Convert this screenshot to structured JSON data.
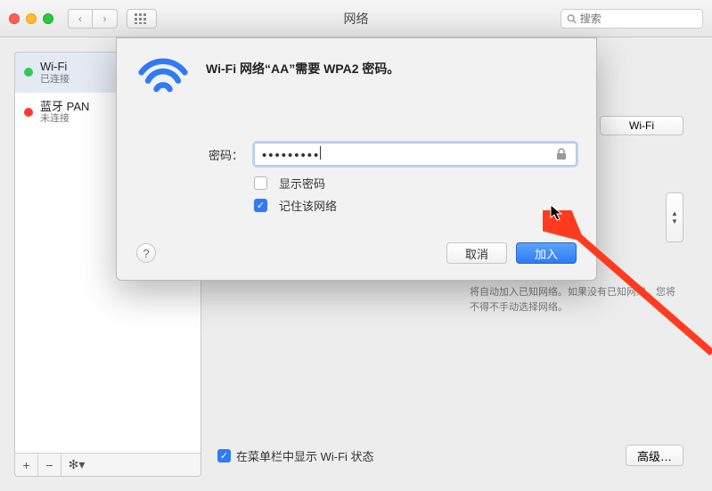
{
  "window": {
    "title": "网络",
    "search_placeholder": "搜索"
  },
  "sidebar": {
    "items": [
      {
        "name": "Wi-Fi",
        "status": "已连接",
        "dot": "green",
        "selected": true
      },
      {
        "name": "蓝牙 PAN",
        "status": "未连接",
        "dot": "red",
        "selected": false
      }
    ],
    "footer": {
      "add": "+",
      "remove": "−",
      "gear": "✻▾"
    }
  },
  "right": {
    "wifi_button": "Wi-Fi",
    "help_text": "将自动加入已知网络。如果没有已知网络，您将不得不手动选择网络。",
    "menubar_check_label": "在菜单栏中显示 Wi-Fi 状态",
    "advanced_button": "高级…"
  },
  "modal": {
    "title": "Wi-Fi 网络“AA”需要 WPA2 密码。",
    "password_label": "密码：",
    "password_value": "•••••••••",
    "show_password_label": "显示密码",
    "remember_label": "记住该网络",
    "cancel_label": "取消",
    "join_label": "加入",
    "show_password_checked": false,
    "remember_checked": true
  }
}
